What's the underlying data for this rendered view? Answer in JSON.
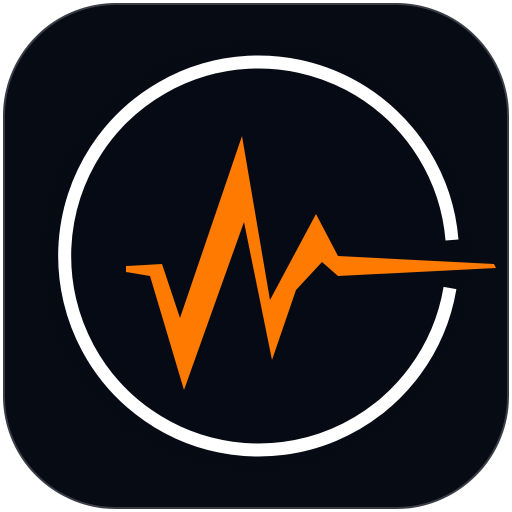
{
  "icon": {
    "name": "seismic-waveform-app-icon",
    "colors": {
      "background": "#050a14",
      "background_edge": "#1a1d24",
      "ring": "#ffffff",
      "waveform": "#ff7a00"
    }
  }
}
